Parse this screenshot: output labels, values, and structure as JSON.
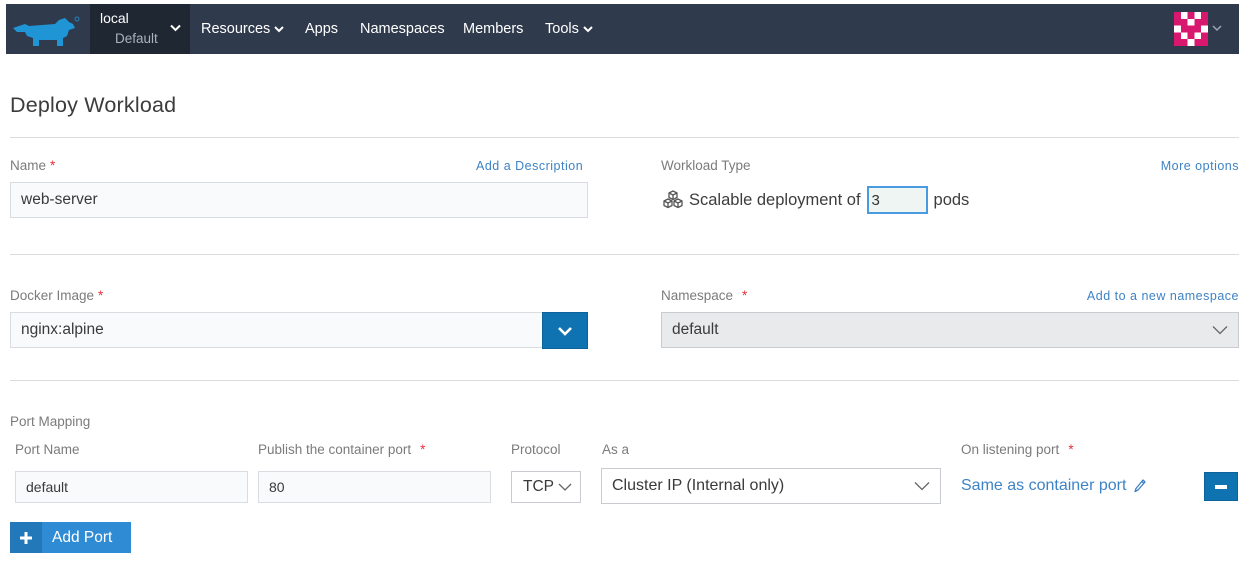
{
  "header": {
    "logo_icon": "rancher-cow-logo",
    "cluster": {
      "name": "local",
      "project": "Default"
    },
    "nav": [
      {
        "label": "Resources",
        "has_dropdown": true
      },
      {
        "label": "Apps",
        "has_dropdown": false
      },
      {
        "label": "Namespaces",
        "has_dropdown": false
      },
      {
        "label": "Members",
        "has_dropdown": false
      },
      {
        "label": "Tools",
        "has_dropdown": true
      }
    ],
    "avatar_icon": "user-avatar-identicon"
  },
  "page": {
    "title": "Deploy Workload"
  },
  "form": {
    "name": {
      "label": "Name",
      "required_mark": "*",
      "value": "web-server",
      "add_description_link": "Add a Description"
    },
    "workload_type": {
      "label": "Workload Type",
      "more_options_link": "More options",
      "prefix": "Scalable deployment of",
      "replicas": "3",
      "suffix": "pods"
    },
    "docker_image": {
      "label": "Docker Image",
      "required_mark": "*",
      "value": "nginx:alpine"
    },
    "namespace": {
      "label": "Namespace",
      "required_mark": "*",
      "add_link": "Add to a new namespace",
      "value": "default"
    },
    "port_mapping": {
      "title": "Port Mapping",
      "columns": {
        "port_name": "Port Name",
        "publish_port": "Publish the container port",
        "protocol": "Protocol",
        "as_a": "As a",
        "listening_port": "On listening port"
      },
      "required_mark": "*",
      "row": {
        "port_name": "default",
        "publish_port": "80",
        "protocol": "TCP",
        "as_a": "Cluster IP (Internal only)",
        "listening_port": "Same as container port"
      },
      "add_port_label": "Add Port"
    }
  },
  "colors": {
    "topbar": "#2f3b4c",
    "cluster_bg": "#1f2733",
    "primary": "#0f73b1",
    "link": "#3e83c5",
    "required": "#e2323a",
    "add_port": "#2f8cd4"
  }
}
